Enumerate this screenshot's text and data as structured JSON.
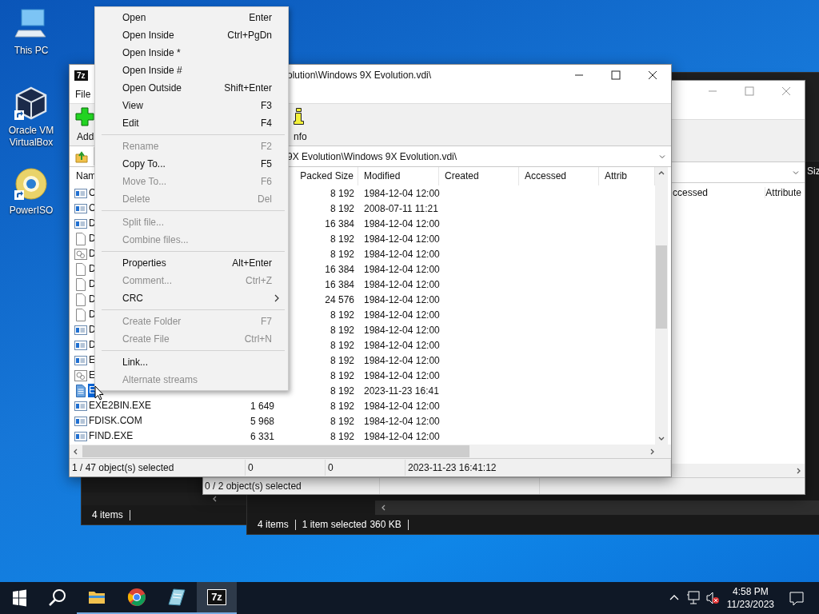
{
  "desktop_icons": [
    {
      "label": "This PC",
      "kind": "computer",
      "shortcut": false
    },
    {
      "label": "Oracle VM VirtualBox",
      "kind": "cube",
      "shortcut": true
    },
    {
      "label": "PowerISO",
      "kind": "disc",
      "shortcut": true
    }
  ],
  "explorer_back": {
    "status": "4 items"
  },
  "explorer_front": {
    "column": "Siz",
    "status_items": "4 items",
    "status_selected": "1 item selected",
    "status_size": "360 KB"
  },
  "archive_back": {
    "columns": [
      "ccessed",
      "Attribute"
    ],
    "status": "0 / 2 object(s) selected"
  },
  "archive_front": {
    "logo": "7z",
    "title": "olution\\Windows 9X Evolution.vdi\\",
    "menu": [
      "File"
    ],
    "toolbar": [
      {
        "label": "Add",
        "kind": "add"
      },
      {
        "label": "nfo",
        "kind": "info"
      }
    ],
    "address": "9X Evolution\\Windows 9X Evolution.vdi\\",
    "columns": [
      "Nam",
      "Packed Size",
      "Modified",
      "Created",
      "Accessed",
      "Attrib"
    ],
    "rows": [
      {
        "name": "C",
        "kind": "program",
        "packed": "8 192",
        "modified": "1984-12-04 12:00",
        "selected": false
      },
      {
        "name": "C",
        "kind": "program",
        "packed": "8 192",
        "modified": "2008-07-11 11:21",
        "selected": false
      },
      {
        "name": "D",
        "kind": "program",
        "packed": "16 384",
        "modified": "1984-12-04 12:00",
        "selected": false
      },
      {
        "name": "D",
        "kind": "document",
        "packed": "8 192",
        "modified": "1984-12-04 12:00",
        "selected": false
      },
      {
        "name": "D",
        "kind": "settings",
        "packed": "8 192",
        "modified": "1984-12-04 12:00",
        "selected": false
      },
      {
        "name": "D",
        "kind": "document",
        "packed": "16 384",
        "modified": "1984-12-04 12:00",
        "selected": false
      },
      {
        "name": "D",
        "kind": "document",
        "packed": "16 384",
        "modified": "1984-12-04 12:00",
        "selected": false
      },
      {
        "name": "D",
        "kind": "document",
        "packed": "24 576",
        "modified": "1984-12-04 12:00",
        "selected": false
      },
      {
        "name": "D",
        "kind": "document",
        "packed": "8 192",
        "modified": "1984-12-04 12:00",
        "selected": false
      },
      {
        "name": "D",
        "kind": "program",
        "packed": "8 192",
        "modified": "1984-12-04 12:00",
        "selected": false
      },
      {
        "name": "D",
        "kind": "program",
        "packed": "8 192",
        "modified": "1984-12-04 12:00",
        "selected": false
      },
      {
        "name": "E",
        "kind": "program",
        "packed": "8 192",
        "modified": "1984-12-04 12:00",
        "selected": false
      },
      {
        "name": "E",
        "kind": "settings",
        "packed": "8 192",
        "modified": "1984-12-04 12:00",
        "selected": false
      },
      {
        "name": "E",
        "kind": "text",
        "packed": "8 192",
        "modified": "2023-11-23 16:41",
        "selected": true
      },
      {
        "name": "EXE2BIN.EXE",
        "kind": "program",
        "size": "1 649",
        "packed": "8 192",
        "modified": "1984-12-04 12:00",
        "selected": false
      },
      {
        "name": "FDISK.COM",
        "kind": "program",
        "size": "5 968",
        "packed": "8 192",
        "modified": "1984-12-04 12:00",
        "selected": false
      },
      {
        "name": "FIND.EXE",
        "kind": "program",
        "size": "6 331",
        "packed": "8 192",
        "modified": "1984-12-04 12:00",
        "selected": false
      }
    ],
    "status": [
      "1 / 47 object(s) selected",
      "0",
      "0",
      "2023-11-23 16:41:12"
    ]
  },
  "context_menu": [
    {
      "kind": "item",
      "label": "Open",
      "shortcut": "Enter",
      "disabled": false
    },
    {
      "kind": "item",
      "label": "Open Inside",
      "shortcut": "Ctrl+PgDn",
      "disabled": false
    },
    {
      "kind": "item",
      "label": "Open Inside *",
      "disabled": false
    },
    {
      "kind": "item",
      "label": "Open Inside #",
      "disabled": false
    },
    {
      "kind": "item",
      "label": "Open Outside",
      "shortcut": "Shift+Enter",
      "disabled": false
    },
    {
      "kind": "item",
      "label": "View",
      "shortcut": "F3",
      "disabled": false
    },
    {
      "kind": "item",
      "label": "Edit",
      "shortcut": "F4",
      "disabled": false
    },
    {
      "kind": "separator"
    },
    {
      "kind": "item",
      "label": "Rename",
      "shortcut": "F2",
      "disabled": true
    },
    {
      "kind": "item",
      "label": "Copy To...",
      "shortcut": "F5",
      "disabled": false
    },
    {
      "kind": "item",
      "label": "Move To...",
      "shortcut": "F6",
      "disabled": true
    },
    {
      "kind": "item",
      "label": "Delete",
      "shortcut": "Del",
      "disabled": true
    },
    {
      "kind": "separator"
    },
    {
      "kind": "item",
      "label": "Split file...",
      "disabled": true
    },
    {
      "kind": "item",
      "label": "Combine files...",
      "disabled": true
    },
    {
      "kind": "separator"
    },
    {
      "kind": "item",
      "label": "Properties",
      "shortcut": "Alt+Enter",
      "disabled": false
    },
    {
      "kind": "item",
      "label": "Comment...",
      "shortcut": "Ctrl+Z",
      "disabled": true
    },
    {
      "kind": "submenu",
      "label": "CRC",
      "disabled": false
    },
    {
      "kind": "separator"
    },
    {
      "kind": "item",
      "label": "Create Folder",
      "shortcut": "F7",
      "disabled": true
    },
    {
      "kind": "item",
      "label": "Create File",
      "shortcut": "Ctrl+N",
      "disabled": true
    },
    {
      "kind": "separator"
    },
    {
      "kind": "item",
      "label": "Link...",
      "disabled": false
    },
    {
      "kind": "item",
      "label": "Alternate streams",
      "disabled": true
    }
  ],
  "taskbar": {
    "apps": [
      {
        "kind": "folder",
        "running": true,
        "selected": false
      },
      {
        "kind": "browser",
        "running": true,
        "selected": false
      },
      {
        "kind": "notepad",
        "running": true,
        "selected": false
      },
      {
        "kind": "archiver",
        "label": "7z",
        "running": true,
        "selected": true
      }
    ],
    "volume_muted": true,
    "time": "4:58 PM",
    "date": "11/23/2023"
  }
}
